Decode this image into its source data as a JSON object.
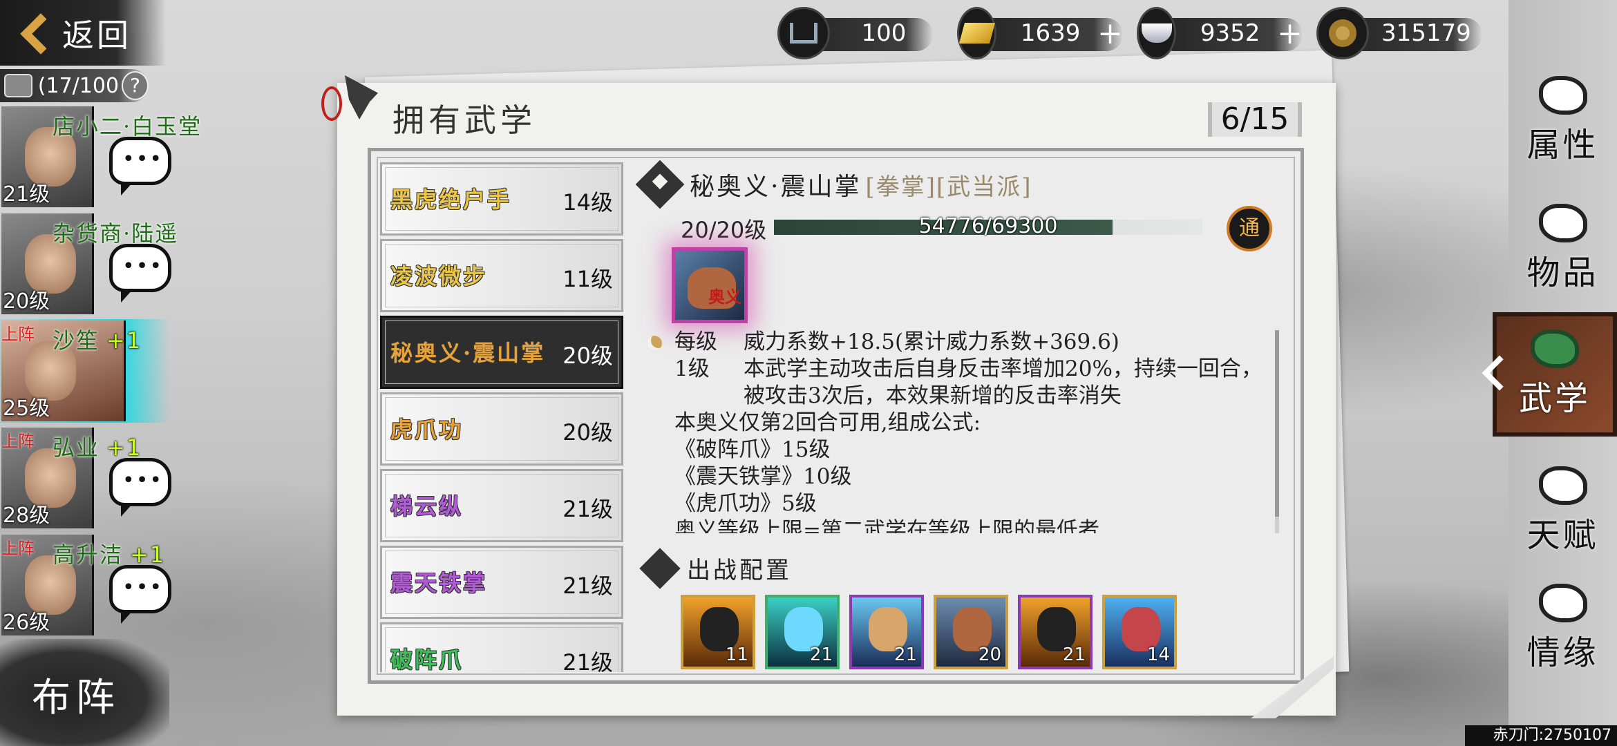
{
  "back_label": "返回",
  "capacity": "(17/100",
  "capacity_help": "?",
  "currencies": [
    {
      "id": "stamina",
      "value": "100",
      "icon": "cauldron-icon",
      "add": ""
    },
    {
      "id": "gold",
      "value": "1639",
      "icon": "gold-ingot-icon",
      "add": "+"
    },
    {
      "id": "silver",
      "value": "9352",
      "icon": "silver-ingot-icon",
      "add": "+"
    },
    {
      "id": "copper",
      "value": "315179",
      "icon": "copper-coin-icon",
      "add": "+"
    }
  ],
  "roster": [
    {
      "name": "店小二·白玉堂",
      "level": "21级",
      "on": "",
      "bonus": ""
    },
    {
      "name": "杂货商·陆遥",
      "level": "20级",
      "on": "",
      "bonus": ""
    },
    {
      "name": "沙笙",
      "level": "25级",
      "on": "上阵",
      "bonus": "+1"
    },
    {
      "name": "弘业",
      "level": "28级",
      "on": "上阵",
      "bonus": "+1"
    },
    {
      "name": "高升洁",
      "level": "26级",
      "on": "上阵",
      "bonus": "+1"
    }
  ],
  "formation_label": "布阵",
  "panel_title": "拥有武学",
  "skill_count": "6/15",
  "skills": [
    {
      "name": "黑虎绝户手",
      "level": "14级",
      "color": "#e9c64a"
    },
    {
      "name": "凌波微步",
      "level": "11级",
      "color": "#e9c64a"
    },
    {
      "name": "秘奥义·震山掌",
      "level": "20级",
      "color": "#e8a23a"
    },
    {
      "name": "虎爪功",
      "level": "20级",
      "color": "#e8a23a"
    },
    {
      "name": "梯云纵",
      "level": "21级",
      "color": "#b35ad9"
    },
    {
      "name": "震天铁掌",
      "level": "21级",
      "color": "#b35ad9"
    },
    {
      "name": "破阵爪",
      "level": "21级",
      "color": "#3fbf5a"
    }
  ],
  "detail": {
    "name": "秘奥义·震山掌",
    "tags": "[拳掌][武当派]",
    "level": "20/20级",
    "xp_text": "54776/69300",
    "xp_fraction": 0.79,
    "badge": "通",
    "icon_mark": "奥义",
    "per_level_key": "每级",
    "per_level_val": "威力系数+18.5(累计威力系数+369.6)",
    "lv1_key": "1级",
    "lv1_val": "本武学主动攻击后自身反击率增加20%，持续一回合，被攻击3次后，本效果新增的反击率消失",
    "note": "本奥义仅第2回合可用,组成公式:",
    "formula": [
      "《破阵爪》15级",
      "《震天铁掌》10级",
      "《虎爪功》5级"
    ],
    "cut_line": "奥义等级上限=第二武学在等级上限的最低者"
  },
  "battle_title": "出战配置",
  "battle_slots": [
    {
      "level": "11",
      "icon": "figure-icon"
    },
    {
      "level": "21",
      "icon": "wave-icon"
    },
    {
      "level": "21",
      "icon": "palm-icon"
    },
    {
      "level": "20",
      "icon": "claw-icon"
    },
    {
      "level": "21",
      "icon": "figure-icon"
    },
    {
      "level": "14",
      "icon": "lightning-hand-icon"
    }
  ],
  "nav": [
    {
      "label": "属性",
      "icon": "bird-icon"
    },
    {
      "label": "物品",
      "icon": "gift-box-icon"
    },
    {
      "label": "武学",
      "icon": "book-stack-icon"
    },
    {
      "label": "天赋",
      "icon": "talent-icon"
    },
    {
      "label": "情缘",
      "icon": "heart-icon"
    }
  ],
  "footer": "赤刀门:2750107"
}
